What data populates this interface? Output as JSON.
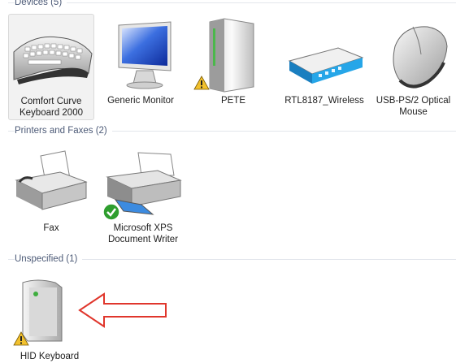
{
  "groups": {
    "devices": {
      "label": "Devices (5)",
      "items": [
        {
          "label": "Comfort Curve Keyboard 2000",
          "icon": "keyboard-icon",
          "selected": true
        },
        {
          "label": "Generic Monitor",
          "icon": "monitor-icon"
        },
        {
          "label": "PETE",
          "icon": "computer-tower-icon",
          "status": "warning"
        },
        {
          "label": "RTL8187_Wireless",
          "icon": "wireless-adapter-icon"
        },
        {
          "label": "USB-PS/2 Optical Mouse",
          "icon": "mouse-icon"
        }
      ]
    },
    "printers": {
      "label": "Printers and Faxes (2)",
      "items": [
        {
          "label": "Fax",
          "icon": "fax-icon"
        },
        {
          "label": "Microsoft XPS Document Writer",
          "icon": "printer-icon",
          "status": "default"
        }
      ]
    },
    "unspecified": {
      "label": "Unspecified (1)",
      "items": [
        {
          "label": "HID Keyboard Device",
          "icon": "generic-device-icon",
          "status": "warning"
        }
      ]
    }
  },
  "annotation": {
    "icon": "red-arrow-icon",
    "color": "#e0362c"
  },
  "colors": {
    "group_text": "#4c5a77",
    "selection_bg": "#f2f2f2",
    "warning": "#f2c12e",
    "ok": "#2e9e2e"
  }
}
